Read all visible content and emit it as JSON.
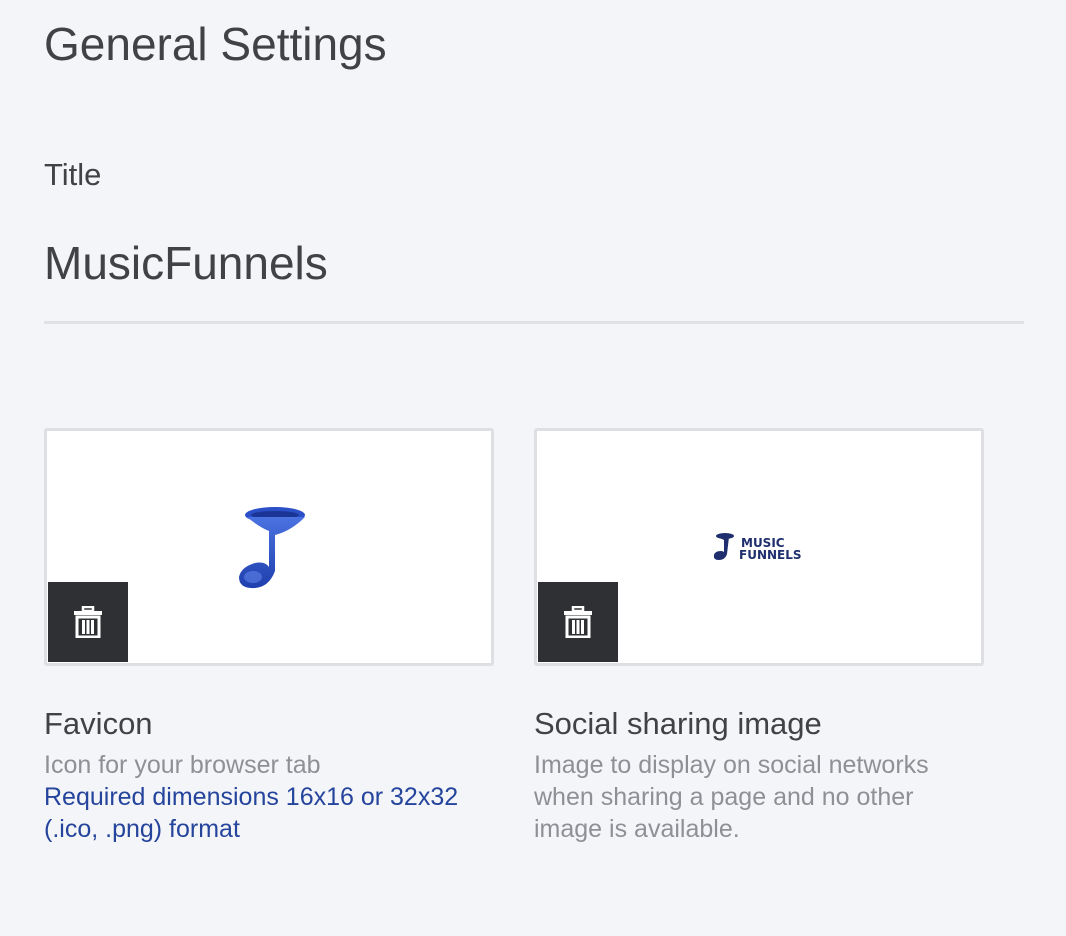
{
  "page": {
    "title": "General Settings"
  },
  "title_field": {
    "label": "Title",
    "value": "MusicFunnels"
  },
  "favicon": {
    "title": "Favicon",
    "description": "Icon for your browser tab",
    "requirement": "Required dimensions 16x16 or 32x32 (.ico, .png) format",
    "delete_icon": "trash-icon",
    "image_icon": "music-note-icon"
  },
  "social_image": {
    "title": "Social sharing image",
    "description": "Image to display on social networks when sharing a page and no other image is available.",
    "delete_icon": "trash-icon",
    "logo_text_line1": "MUSIC",
    "logo_text_line2": "FUNNELS"
  },
  "colors": {
    "accent_link": "#25449c",
    "delete_button": "#2e3034",
    "logo_blue": "#2a4fc4"
  }
}
